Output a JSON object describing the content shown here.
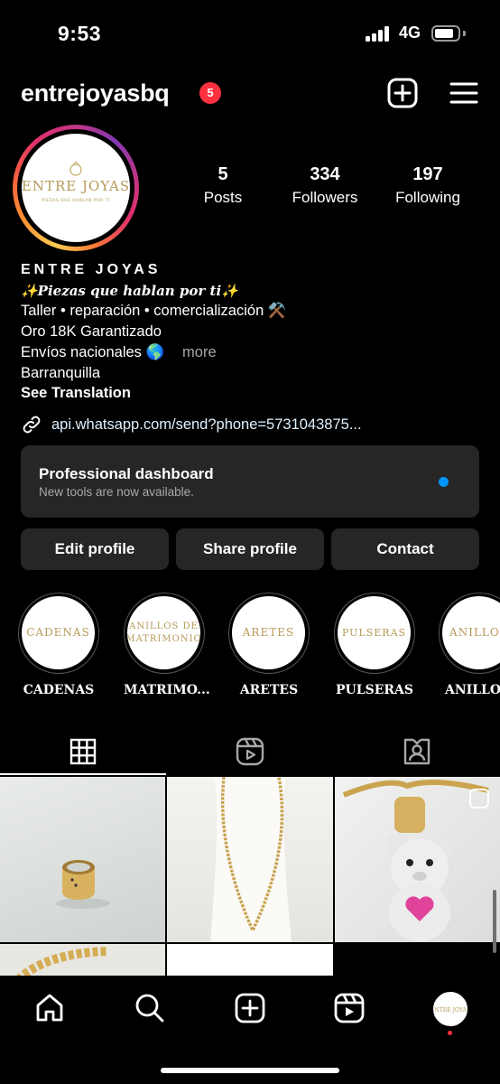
{
  "status_bar": {
    "time": "9:53",
    "network": "4G"
  },
  "header": {
    "username": "entrejoyasbq",
    "notification_count": "5"
  },
  "profile": {
    "avatar_text": "ENTRE JOYAS",
    "avatar_tagline": "PIEZAS QUE HABLAN POR TI",
    "stats": [
      {
        "value": "5",
        "label": "Posts"
      },
      {
        "value": "334",
        "label": "Followers"
      },
      {
        "value": "197",
        "label": "Following"
      }
    ]
  },
  "bio": {
    "name": "ENTRE JOYAS",
    "tagline": "✨𝑷𝒊𝒆𝒛𝒂𝒔 𝒒𝒖𝒆 𝒉𝒂𝒃𝒍𝒂𝒏 𝒑𝒐𝒓 𝒕𝒊✨",
    "line1": "Taller • reparación • comercialización ⚒️",
    "line2": "Oro 18K Garantizado",
    "line3": "Envíos nacionales 🌎",
    "more": "more",
    "location": "Barranquilla",
    "see_translation": "See Translation"
  },
  "link": {
    "text": "api.whatsapp.com/send?phone=5731043875..."
  },
  "dashboard": {
    "title": "Professional dashboard",
    "subtitle": "New tools are now available."
  },
  "buttons": {
    "edit": "Edit profile",
    "share": "Share profile",
    "contact": "Contact"
  },
  "highlights": [
    {
      "label": "CADENAS",
      "cover": "CADENAS"
    },
    {
      "label": "MATRIMO...",
      "cover": "ANILLOS DE MATRIMONIO"
    },
    {
      "label": "ARETES",
      "cover": "ARETES"
    },
    {
      "label": "PULSERAS",
      "cover": "PULSERAS"
    },
    {
      "label": "ANILLO",
      "cover": "ANILLOS"
    }
  ],
  "tabs": [
    "grid-icon",
    "reels-icon",
    "tagged-icon"
  ],
  "colors": {
    "accent_blue": "#0095f6",
    "badge_red": "#ff3040",
    "gold": "#b69a57",
    "card": "#262626"
  }
}
